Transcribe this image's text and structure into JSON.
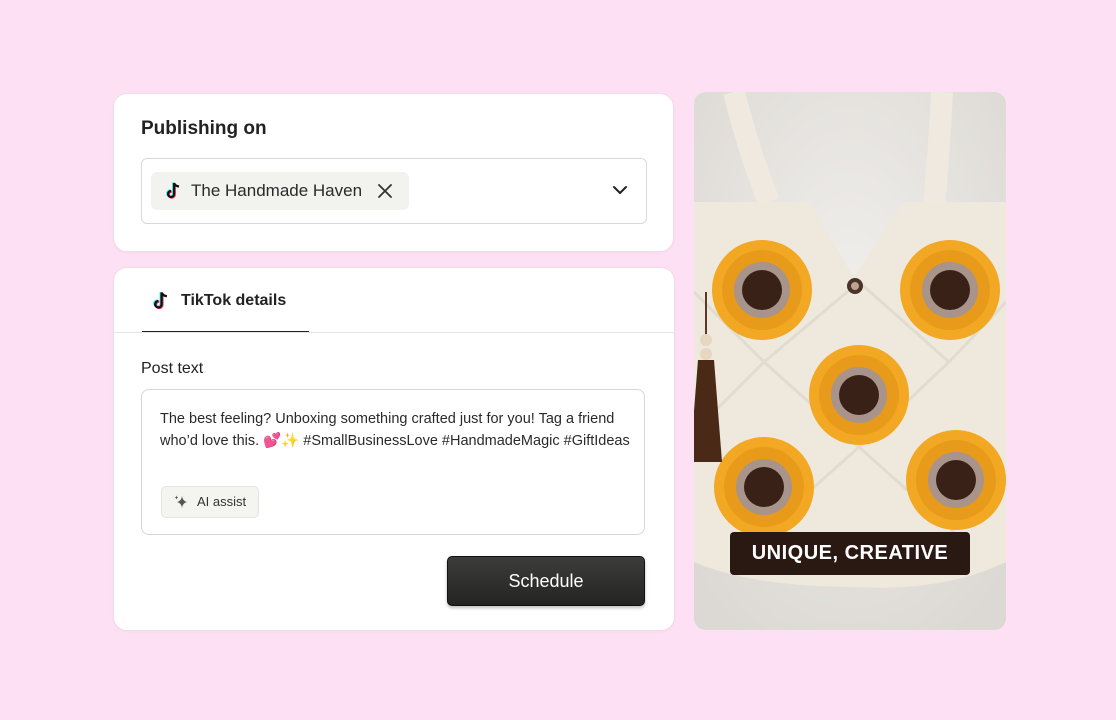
{
  "publishing": {
    "title": "Publishing on",
    "selected_account": "The Handmade Haven",
    "account_platform_icon": "tiktok-icon"
  },
  "details": {
    "tab_label": "TikTok details",
    "post_text_label": "Post text",
    "post_text": "The best feeling? Unboxing something crafted just for you! Tag a friend who’d love this. 💕✨ #SmallBusinessLove #HandmadeMagic #GiftIdeas",
    "ai_assist_label": "AI assist",
    "schedule_label": "Schedule"
  },
  "preview": {
    "overlay_text": "UNIQUE, CREATIVE",
    "image_subject": "crochet sunflower granny-square tote bag"
  },
  "colors": {
    "background": "#fde0f3",
    "button_dark": "#2e2e2d",
    "overlay_bg": "#2a1812"
  }
}
